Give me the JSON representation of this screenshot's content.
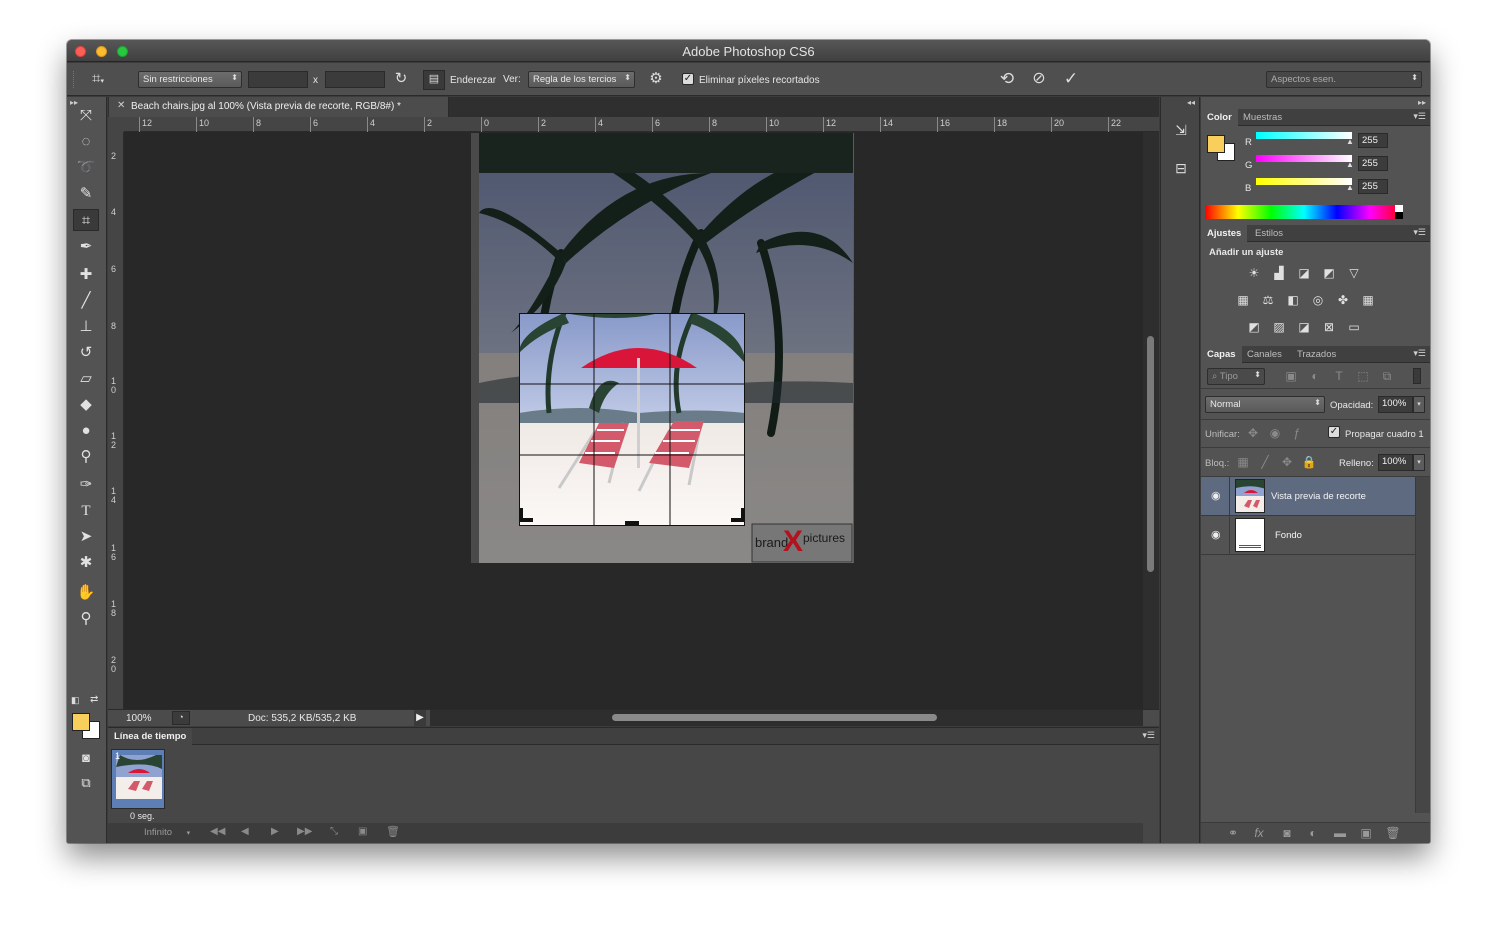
{
  "window": {
    "title": "Adobe Photoshop CS6"
  },
  "options_bar": {
    "crop_icon": "crop-icon",
    "ratio_preset": "Sin restricciones",
    "width_value": "",
    "x_label": "x",
    "height_value": "",
    "swap_icon": "swap-icon",
    "straighten_label": "Enderezar",
    "view_label": "Ver:",
    "overlay_value": "Regla de los tercios",
    "settings_icon": "gear-icon",
    "delete_cropped_label": "Eliminar píxeles recortados",
    "delete_cropped_checked": true,
    "reset_icon": "undo-icon",
    "cancel_icon": "cancel-icon",
    "commit_icon": "checkmark-icon",
    "workspace_value": "Aspectos esen."
  },
  "tools": [
    {
      "name": "move-tool",
      "glyph": "⤧"
    },
    {
      "name": "marquee-tool",
      "glyph": "◌"
    },
    {
      "name": "lasso-tool",
      "glyph": "➰"
    },
    {
      "name": "quick-select-tool",
      "glyph": "✎"
    },
    {
      "name": "crop-tool",
      "glyph": "⌗"
    },
    {
      "name": "eyedropper-tool",
      "glyph": "✒"
    },
    {
      "name": "healing-brush-tool",
      "glyph": "✚"
    },
    {
      "name": "brush-tool",
      "glyph": "╱"
    },
    {
      "name": "clone-stamp-tool",
      "glyph": "⊥"
    },
    {
      "name": "history-brush-tool",
      "glyph": "↺"
    },
    {
      "name": "eraser-tool",
      "glyph": "▱"
    },
    {
      "name": "paint-bucket-tool",
      "glyph": "◆"
    },
    {
      "name": "blur-tool",
      "glyph": "●"
    },
    {
      "name": "dodge-tool",
      "glyph": "⚲"
    },
    {
      "name": "pen-tool",
      "glyph": "✑"
    },
    {
      "name": "type-tool",
      "glyph": "T"
    },
    {
      "name": "path-select-tool",
      "glyph": "➤"
    },
    {
      "name": "shape-tool",
      "glyph": "✱"
    },
    {
      "name": "hand-tool",
      "glyph": "✋"
    },
    {
      "name": "zoom-tool",
      "glyph": "⚲"
    }
  ],
  "document": {
    "tab_title": "Beach chairs.jpg al 100% (Vista previa de recorte, RGB/8#) *",
    "ruler_h": [
      "12",
      "10",
      "8",
      "6",
      "4",
      "2",
      "0",
      "2",
      "4",
      "6",
      "8",
      "10",
      "12",
      "14",
      "16",
      "18",
      "20",
      "22"
    ],
    "ruler_v": [
      "2",
      "4",
      "6",
      "8",
      "1\n0",
      "1\n2",
      "1\n4",
      "1\n6",
      "1\n8",
      "2\n0"
    ],
    "watermark_left": "brand",
    "watermark_x": "X",
    "watermark_right": "pictures"
  },
  "status": {
    "zoom": "100%",
    "doc_info": "Doc: 535,2 KB/535,2 KB"
  },
  "timeline": {
    "title": "Línea de tiempo",
    "frame_number": "1",
    "frame_delay": "0 seg.",
    "loop_value": "Infinito"
  },
  "color_panel": {
    "tab_color": "Color",
    "tab_swatches": "Muestras",
    "foreground": "#f9cf5c",
    "background": "#ffffff",
    "r_label": "R",
    "g_label": "G",
    "b_label": "B",
    "r_value": "255",
    "g_value": "255",
    "b_value": "255"
  },
  "adjustments_panel": {
    "tab_adjustments": "Ajustes",
    "tab_styles": "Estilos",
    "heading": "Añadir un ajuste"
  },
  "layers_panel": {
    "tab_layers": "Capas",
    "tab_channels": "Canales",
    "tab_paths": "Trazados",
    "filter_kind": "Tipo",
    "blend_mode": "Normal",
    "opacity_label": "Opacidad:",
    "opacity_value": "100%",
    "unify_label": "Unificar:",
    "propagate_label": "Propagar cuadro 1",
    "lock_label": "Bloq.:",
    "fill_label": "Relleno:",
    "fill_value": "100%",
    "layers": [
      {
        "name": "Vista previa de recorte",
        "selected": true
      },
      {
        "name": "Fondo",
        "selected": false
      }
    ]
  }
}
